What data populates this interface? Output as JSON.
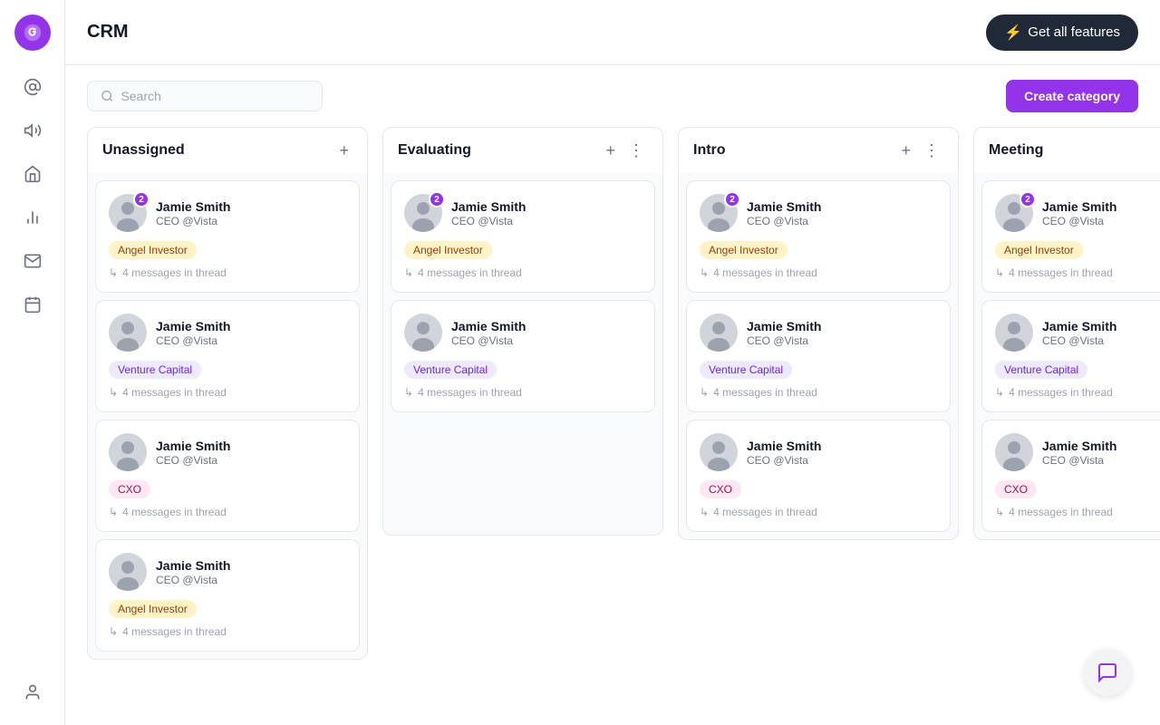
{
  "app": {
    "title": "CRM"
  },
  "header": {
    "get_all_features_label": "Get all features"
  },
  "toolbar": {
    "search_placeholder": "Search",
    "create_category_label": "Create category"
  },
  "columns": [
    {
      "id": "unassigned",
      "title": "Unassigned",
      "has_add": true,
      "has_more": false,
      "has_minus": false
    },
    {
      "id": "evaluating",
      "title": "Evaluating",
      "has_add": true,
      "has_more": true,
      "has_minus": false
    },
    {
      "id": "intro",
      "title": "Intro",
      "has_add": true,
      "has_more": true,
      "has_minus": false
    },
    {
      "id": "meeting",
      "title": "Meeting",
      "has_add": false,
      "has_more": false,
      "has_minus": true
    }
  ],
  "cards": {
    "unassigned": [
      {
        "name": "Jamie Smith",
        "role": "CEO @Vista",
        "badge": 2,
        "tag": "Angel Investor",
        "tag_type": "angel",
        "thread_count": "4 messages in thread"
      },
      {
        "name": "Jamie Smith",
        "role": "CEO @Vista",
        "badge": null,
        "tag": "Venture Capital",
        "tag_type": "venture",
        "thread_count": "4 messages in thread"
      },
      {
        "name": "Jamie Smith",
        "role": "CEO @Vista",
        "badge": null,
        "tag": "CXO",
        "tag_type": "cxo",
        "thread_count": "4 messages in thread"
      },
      {
        "name": "Jamie Smith",
        "role": "CEO @Vista",
        "badge": null,
        "tag": "Angel Investor",
        "tag_type": "angel",
        "thread_count": "4 messages in thread"
      }
    ],
    "evaluating": [
      {
        "name": "Jamie Smith",
        "role": "CEO @Vista",
        "badge": 2,
        "tag": "Angel Investor",
        "tag_type": "angel",
        "thread_count": "4 messages in thread"
      },
      {
        "name": "Jamie Smith",
        "role": "CEO @Vista",
        "badge": null,
        "tag": "Venture Capital",
        "tag_type": "venture",
        "thread_count": "4 messages in thread"
      }
    ],
    "intro": [
      {
        "name": "Jamie Smith",
        "role": "CEO @Vista",
        "badge": 2,
        "tag": "Angel Investor",
        "tag_type": "angel",
        "thread_count": "4 messages in thread"
      },
      {
        "name": "Jamie Smith",
        "role": "CEO @Vista",
        "badge": null,
        "tag": "Venture Capital",
        "tag_type": "venture",
        "thread_count": "4 messages in thread"
      },
      {
        "name": "Jamie Smith",
        "role": "CEO @Vista",
        "badge": null,
        "tag": "CXO",
        "tag_type": "cxo",
        "thread_count": "4 messages in thread"
      }
    ],
    "meeting": [
      {
        "name": "Jamie Smith",
        "role": "CEO @Vista",
        "badge": 2,
        "tag": "Angel Investor",
        "tag_type": "angel",
        "thread_count": "4 messages in thread"
      },
      {
        "name": "Jamie Smith",
        "role": "CEO @Vista",
        "badge": null,
        "tag": "Venture Capital",
        "tag_type": "venture",
        "thread_count": "4 messages in thread"
      },
      {
        "name": "Jamie Smith",
        "role": "CEO @Vista",
        "badge": null,
        "tag": "CXO",
        "tag_type": "cxo",
        "thread_count": "4 messages in thread"
      }
    ]
  },
  "sidebar": {
    "items": [
      {
        "id": "at",
        "icon": "at-icon"
      },
      {
        "id": "speaker",
        "icon": "speaker-icon"
      },
      {
        "id": "building",
        "icon": "building-icon"
      },
      {
        "id": "signal",
        "icon": "signal-icon"
      },
      {
        "id": "mail",
        "icon": "mail-icon"
      },
      {
        "id": "calendar",
        "icon": "calendar-icon"
      }
    ]
  },
  "thread_label": "4 messages in thread"
}
